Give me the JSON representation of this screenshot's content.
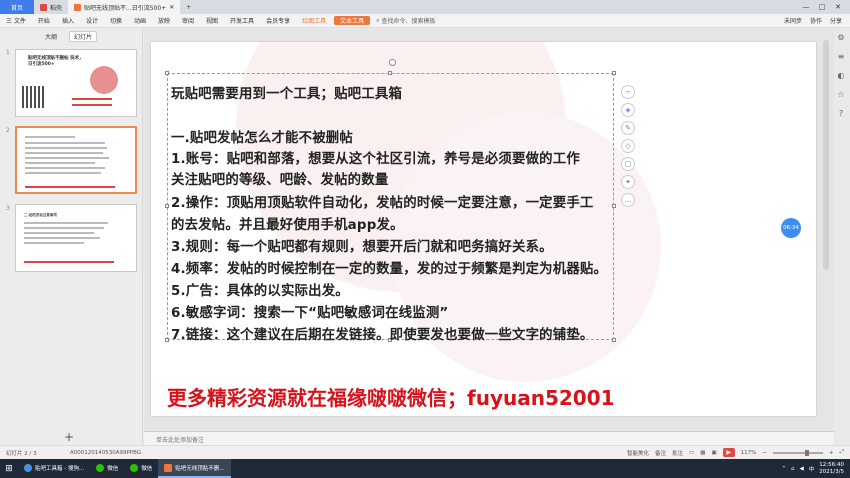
{
  "tabs": {
    "home": "首页",
    "t2": "稻壳",
    "t3": "贴吧无线顶贴不...日引流500+"
  },
  "menu": {
    "file": "三 文件",
    "items": [
      "开始",
      "插入",
      "设计",
      "切换",
      "动画",
      "放映",
      "审阅",
      "视图",
      "开发工具",
      "会员专享"
    ],
    "special1": "绘图工具",
    "special2": "文本工具",
    "search": "查找命令、搜索模板",
    "right": [
      "未同步",
      "协作",
      "分享"
    ]
  },
  "left_panel": {
    "tab_outline": "大纲",
    "tab_slides": "幻灯片",
    "slide1_title": "贴吧无线顶贴不删帖 技术，日引流500+",
    "slide3_title": "二.贴吧发帖注意事项"
  },
  "slide": {
    "lines": [
      "玩贴吧需要用到一个工具；贴吧工具箱",
      "",
      "一.贴吧发帖怎么才能不被删帖",
      "1.账号：贴吧和部落，想要从这个社区引流，养号是必须要做的工作",
      "关注贴吧的等级、吧龄、发帖的数量",
      "2.操作：顶贴用顶贴软件自动化，发帖的时候一定要注意，一定要手工",
      "的去发帖。并且最好使用手机app发。",
      "3.规则：每一个贴吧都有规则，想要开后门就和吧务搞好关系。",
      "4.频率：发帖的时候控制在一定的数量，发的过于频繁是判定为机器贴。",
      "5.广告：具体的以实际出发。",
      "6.敏感字词：搜索一下“贴吧敏感词在线监测”",
      "7.链接：这个建议在后期在发链接。即使要发也要做一些文字的铺垫。"
    ],
    "footer": "更多精彩资源就在福缘啵啵微信；fuyuan52001"
  },
  "timer": "06:34",
  "notes_placeholder": "单击此处添加备注",
  "status": {
    "slide_pos": "幻灯片 2 / 3",
    "doc_id": "A000120140530A99PPBG",
    "smart": "智能美化",
    "notes": "备注",
    "comment": "批注",
    "zoom": "117%"
  },
  "taskbar": {
    "items": [
      "贴吧工具箱 - 搜狗...",
      "微信",
      "微信",
      "贴吧无线顶贴不删..."
    ],
    "time": "12:56:40",
    "date": "2021/3/5"
  },
  "colors": {
    "accent": "#f0753b",
    "red_text": "#d6131b",
    "timer": "#3c8ef5"
  }
}
